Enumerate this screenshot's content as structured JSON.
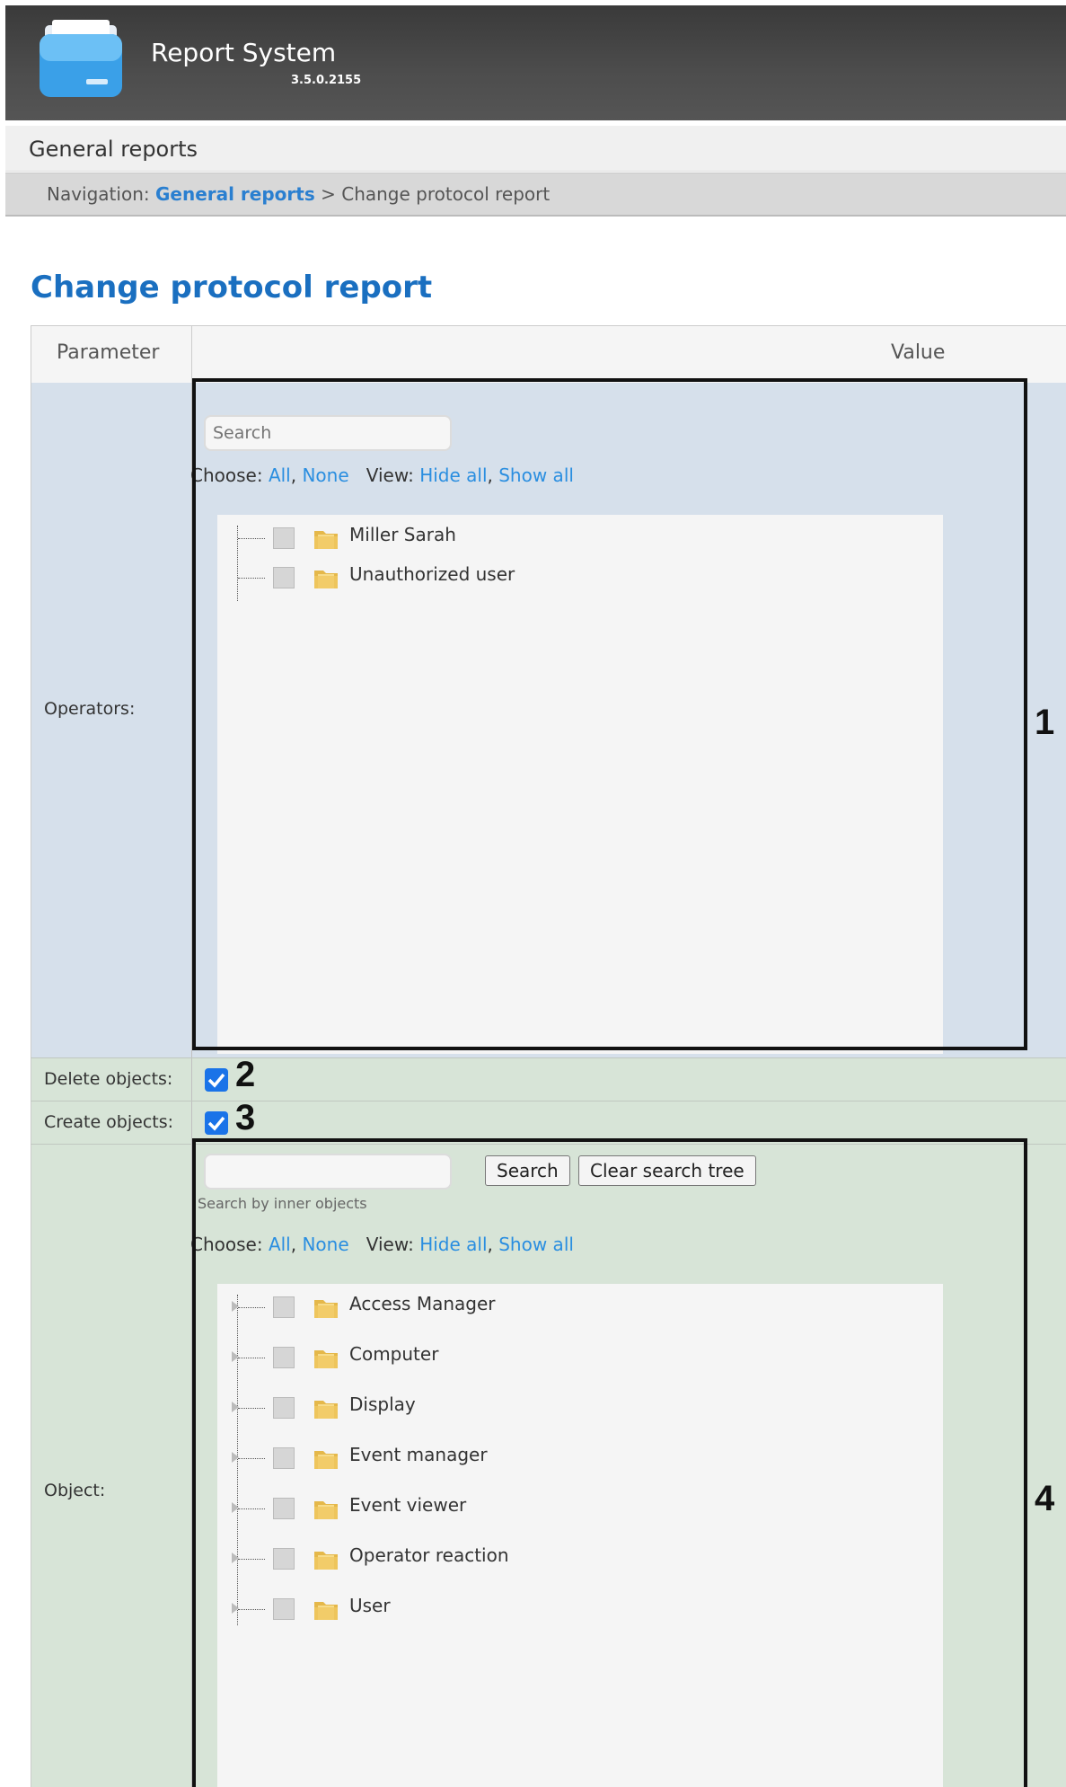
{
  "app": {
    "title": "Report System",
    "version": "3.5.0.2155"
  },
  "section": {
    "title": "General reports"
  },
  "breadcrumb": {
    "prefix": "Navigation:",
    "link": "General reports",
    "separator": ">",
    "current": "Change protocol report"
  },
  "page": {
    "title": "Change protocol report"
  },
  "table": {
    "header_param": "Parameter",
    "header_value": "Value"
  },
  "operators": {
    "label": "Operators:",
    "search_placeholder": "Search",
    "choose_label": "Choose:",
    "choose_all": "All",
    "choose_none": "None",
    "view_label": "View:",
    "view_hide": "Hide all",
    "view_show": "Show all",
    "items": [
      {
        "label": "Miller Sarah"
      },
      {
        "label": "Unauthorized user"
      }
    ]
  },
  "delete_objects": {
    "label": "Delete objects:",
    "checked": true
  },
  "create_objects": {
    "label": "Create objects:",
    "checked": true
  },
  "object": {
    "label": "Object:",
    "search_button": "Search",
    "clear_button": "Clear search tree",
    "hint": "Search by inner objects",
    "choose_label": "Choose:",
    "choose_all": "All",
    "choose_none": "None",
    "view_label": "View:",
    "view_hide": "Hide all",
    "view_show": "Show all",
    "items": [
      {
        "label": "Access Manager"
      },
      {
        "label": "Computer"
      },
      {
        "label": "Display"
      },
      {
        "label": "Event manager"
      },
      {
        "label": "Event viewer"
      },
      {
        "label": "Operator reaction"
      },
      {
        "label": "User"
      }
    ]
  },
  "annotations": {
    "n1": "1",
    "n2": "2",
    "n3": "3",
    "n4": "4"
  },
  "colors": {
    "link": "#2a8ee0",
    "title": "#1a6fc0",
    "operators_bg": "#d6e0eb",
    "object_bg": "#d7e4d7"
  }
}
